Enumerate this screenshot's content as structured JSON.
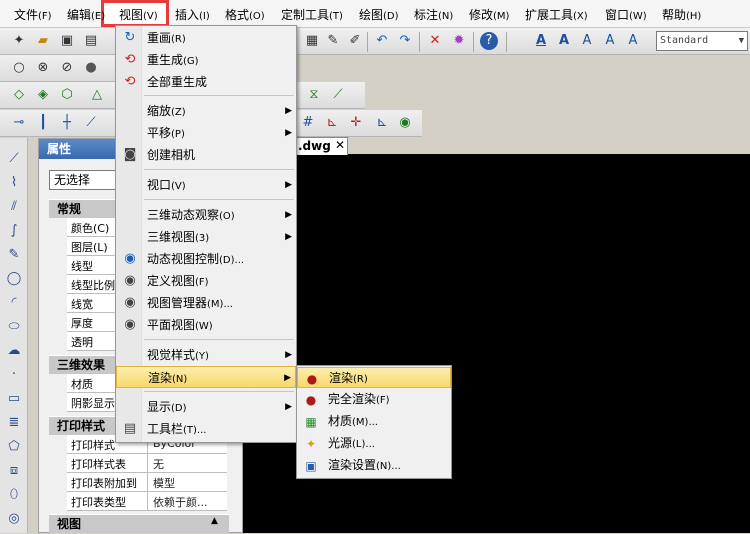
{
  "menubar": {
    "items": [
      {
        "label": "文件",
        "shortcut": "(F)"
      },
      {
        "label": "编辑",
        "shortcut": "(E)"
      },
      {
        "label": "视图",
        "shortcut": "(V)"
      },
      {
        "label": "插入",
        "shortcut": "(I)"
      },
      {
        "label": "格式",
        "shortcut": "(O)"
      },
      {
        "label": "定制工具",
        "shortcut": "(T)"
      },
      {
        "label": "绘图",
        "shortcut": "(D)"
      },
      {
        "label": "标注",
        "shortcut": "(N)"
      },
      {
        "label": "修改",
        "shortcut": "(M)"
      },
      {
        "label": "扩展工具",
        "shortcut": "(X)"
      },
      {
        "label": "窗口",
        "shortcut": "(W)"
      },
      {
        "label": "帮助",
        "shortcut": "(H)"
      }
    ]
  },
  "toolbar": {
    "text_style_value": "Standard"
  },
  "view_menu": {
    "items": [
      {
        "label": "重画",
        "shortcut": "(R)",
        "icon": "redraw-icon"
      },
      {
        "label": "重生成",
        "shortcut": "(G)",
        "icon": "regen-icon"
      },
      {
        "label": "全部重生成",
        "shortcut": "",
        "icon": "regen-all-icon"
      },
      {
        "label": "缩放",
        "shortcut": "(Z)",
        "icon": ""
      },
      {
        "label": "平移",
        "shortcut": "(P)",
        "icon": ""
      },
      {
        "label": "创建相机",
        "shortcut": "",
        "icon": "camera-icon"
      },
      {
        "label": "视口",
        "shortcut": "(V)",
        "icon": ""
      },
      {
        "label": "三维动态观察",
        "shortcut": "(O)",
        "icon": ""
      },
      {
        "label": "三维视图",
        "shortcut": "(3)",
        "icon": ""
      },
      {
        "label": "动态视图控制",
        "shortcut": "(D)...",
        "icon": "dynamic-view-icon"
      },
      {
        "label": "定义视图",
        "shortcut": "(F)",
        "icon": "define-view-icon"
      },
      {
        "label": "视图管理器",
        "shortcut": "(M)...",
        "icon": "view-manager-icon"
      },
      {
        "label": "平面视图",
        "shortcut": "(W)",
        "icon": "plan-view-icon"
      },
      {
        "label": "视觉样式",
        "shortcut": "(Y)",
        "icon": ""
      },
      {
        "label": "渲染",
        "shortcut": "(N)",
        "icon": ""
      },
      {
        "label": "显示",
        "shortcut": "(D)",
        "icon": ""
      },
      {
        "label": "工具栏",
        "shortcut": "(T)...",
        "icon": "toolbar-icon"
      }
    ]
  },
  "render_submenu": {
    "items": [
      {
        "label": "渲染",
        "shortcut": "(R)"
      },
      {
        "label": "完全渲染",
        "shortcut": "(F)"
      },
      {
        "label": "材质",
        "shortcut": "(M)..."
      },
      {
        "label": "光源",
        "shortcut": "(L)..."
      },
      {
        "label": "渲染设置",
        "shortcut": "(N)..."
      }
    ]
  },
  "properties": {
    "title": "属性",
    "selection": "无选择",
    "sections": {
      "general": "常规",
      "effects3d": "三维效果",
      "plot": "打印样式",
      "view": "视图"
    },
    "general_rows": [
      {
        "key": "颜色(C)",
        "value": ""
      },
      {
        "key": "图层(L)",
        "value": ""
      },
      {
        "key": "线型",
        "value": ""
      },
      {
        "key": "线型比例",
        "value": ""
      },
      {
        "key": "线宽",
        "value": ""
      },
      {
        "key": "厚度",
        "value": ""
      },
      {
        "key": "透明",
        "value": ""
      }
    ],
    "effects_rows": [
      {
        "key": "材质",
        "value": ""
      },
      {
        "key": "阴影显示",
        "value": ""
      }
    ],
    "plot_rows": [
      {
        "key": "打印样式",
        "value": "ByColor"
      },
      {
        "key": "打印样式表",
        "value": "无"
      },
      {
        "key": "打印表附加到",
        "value": "模型"
      },
      {
        "key": "打印表类型",
        "value": "依赖于颜..."
      }
    ]
  },
  "document": {
    "tab_label": ".dwg",
    "close_glyph": "✕"
  },
  "colors": {
    "menu_highlight": "#f7d86a",
    "view_outline": "#e83a3a",
    "canvas": "#000000"
  }
}
